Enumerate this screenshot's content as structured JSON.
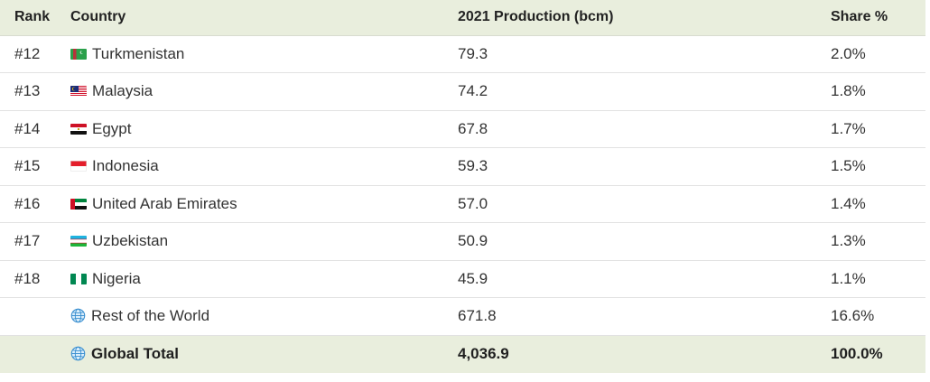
{
  "headers": {
    "rank": "Rank",
    "country": "Country",
    "production": "2021 Production (bcm)",
    "share": "Share %"
  },
  "rows": [
    {
      "rank": "#12",
      "country": "Turkmenistan",
      "production": "79.3",
      "share": "2.0%",
      "icon": "turkmenistan-flag-icon"
    },
    {
      "rank": "#13",
      "country": "Malaysia",
      "production": "74.2",
      "share": "1.8%",
      "icon": "malaysia-flag-icon"
    },
    {
      "rank": "#14",
      "country": "Egypt",
      "production": "67.8",
      "share": "1.7%",
      "icon": "egypt-flag-icon"
    },
    {
      "rank": "#15",
      "country": "Indonesia",
      "production": "59.3",
      "share": "1.5%",
      "icon": "indonesia-flag-icon"
    },
    {
      "rank": "#16",
      "country": "United Arab Emirates",
      "production": "57.0",
      "share": "1.4%",
      "icon": "uae-flag-icon"
    },
    {
      "rank": "#17",
      "country": "Uzbekistan",
      "production": "50.9",
      "share": "1.3%",
      "icon": "uzbekistan-flag-icon"
    },
    {
      "rank": "#18",
      "country": "Nigeria",
      "production": "45.9",
      "share": "1.1%",
      "icon": "nigeria-flag-icon"
    },
    {
      "rank": "",
      "country": "Rest of the World",
      "production": "671.8",
      "share": "16.6%",
      "icon": "globe-icon"
    }
  ],
  "total": {
    "rank": "",
    "country": "Global Total",
    "production": "4,036.9",
    "share": "100.0%",
    "icon": "globe-icon"
  },
  "colors": {
    "header_bg": "#e9eedd",
    "total_bg": "#e9eedd",
    "row_border": "#e2e2e2"
  },
  "chart_data": {
    "type": "table",
    "columns": [
      "Rank",
      "Country",
      "2021 Production (bcm)",
      "Share %"
    ],
    "rows": [
      [
        "#12",
        "Turkmenistan",
        79.3,
        "2.0%"
      ],
      [
        "#13",
        "Malaysia",
        74.2,
        "1.8%"
      ],
      [
        "#14",
        "Egypt",
        67.8,
        "1.7%"
      ],
      [
        "#15",
        "Indonesia",
        59.3,
        "1.5%"
      ],
      [
        "#16",
        "United Arab Emirates",
        57.0,
        "1.4%"
      ],
      [
        "#17",
        "Uzbekistan",
        50.9,
        "1.3%"
      ],
      [
        "#18",
        "Nigeria",
        45.9,
        "1.1%"
      ],
      [
        "",
        "Rest of the World",
        671.8,
        "16.6%"
      ],
      [
        "",
        "Global Total",
        4036.9,
        "100.0%"
      ]
    ]
  }
}
